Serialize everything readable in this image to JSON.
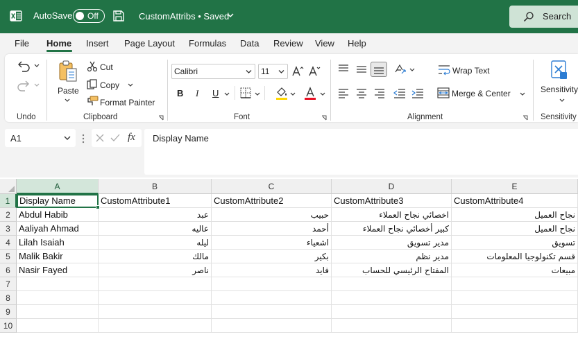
{
  "titlebar": {
    "autosave_label": "AutoSave",
    "autosave_state": "Off",
    "document_title": "CustomAttribs • Saved",
    "search_placeholder": "Search (Alt+Q)",
    "search_visible_text": "Search",
    "icons": [
      "excel-logo-icon",
      "save-icon",
      "chevron-down-icon",
      "search-icon"
    ],
    "color": "#217346"
  },
  "menu": {
    "tabs": [
      "File",
      "Home",
      "Insert",
      "Page Layout",
      "Formulas",
      "Data",
      "Review",
      "View",
      "Help"
    ],
    "active": "Home"
  },
  "ribbon": {
    "undo": {
      "group_label": "Undo"
    },
    "clipboard": {
      "group_label": "Clipboard",
      "paste": "Paste",
      "cut": "Cut",
      "copy": "Copy",
      "format_painter": "Format Painter"
    },
    "font": {
      "group_label": "Font",
      "font_name": "Calibri",
      "font_size": "11",
      "bold": "B",
      "italic": "I",
      "underline": "U",
      "fill_color": "#ffd700",
      "font_color": "#e81123"
    },
    "alignment": {
      "group_label": "Alignment",
      "wrap_text": "Wrap Text",
      "merge_center": "Merge & Center"
    },
    "sensitivity": {
      "group_label": "Sensitivity",
      "button_label": "Sensitivity"
    }
  },
  "formula_bar": {
    "name_box": "A1",
    "fx_symbol": "fx",
    "content": "Display Name"
  },
  "sheet": {
    "columns": [
      "A",
      "B",
      "C",
      "D",
      "E"
    ],
    "rows": [
      "1",
      "2",
      "3",
      "4",
      "5",
      "6",
      "7",
      "8",
      "9",
      "10"
    ],
    "selected_cell": "A1",
    "cells": [
      [
        "Display Name",
        "CustomAttribute1",
        "CustomAttribute2",
        "CustomAttribute3",
        "CustomAttribute4"
      ],
      [
        "Abdul Habib",
        "عبد",
        "حبيب",
        "اخصائي نجاح العملاء",
        "نجاح العميل"
      ],
      [
        "Aaliyah Ahmad",
        "عاليه",
        "أحمد",
        "كبير أخصائي نجاح العملاء",
        "نجاح العميل"
      ],
      [
        "Lilah Isaiah",
        "ليله",
        "اشعياء",
        "مدير تسويق",
        "تسويق"
      ],
      [
        "Malik Bakir",
        "مالك",
        "بكير",
        "مدير نظم",
        "قسم تكنولوجيا المعلومات"
      ],
      [
        "Nasir Fayed",
        "ناصر",
        "فايد",
        "المفتاح الرئيسي للحساب",
        "مبيعات"
      ]
    ]
  }
}
